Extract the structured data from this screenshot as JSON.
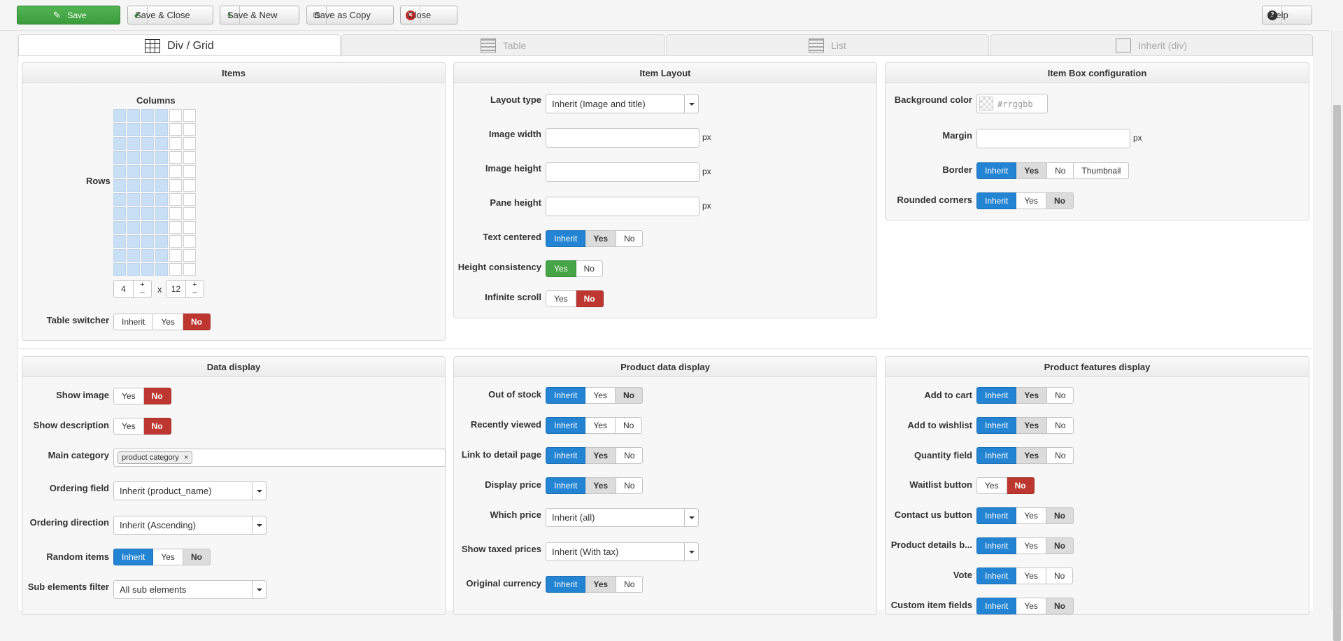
{
  "toolbar": {
    "save": "Save",
    "save_close": "Save & Close",
    "save_new": "Save & New",
    "save_copy": "Save as Copy",
    "close": "Close",
    "help": "Help"
  },
  "tabs": [
    "Div / Grid",
    "Table",
    "List",
    "Inherit (div)"
  ],
  "items_panel": {
    "title": "Items",
    "columns_label": "Columns",
    "rows_label": "Rows",
    "columns_value": "4",
    "x": "x",
    "rows_value": "12",
    "plus": "+",
    "minus": "–",
    "table_switcher": {
      "label": "Table switcher",
      "options": [
        "Inherit",
        "Yes",
        "No"
      ]
    }
  },
  "item_layout": {
    "title": "Item Layout",
    "layout_type": {
      "label": "Layout type",
      "value": "Inherit (Image and title)"
    },
    "image_width": {
      "label": "Image width",
      "unit": "px"
    },
    "image_height": {
      "label": "Image height",
      "unit": "px"
    },
    "pane_height": {
      "label": "Pane height",
      "unit": "px"
    },
    "text_centered": {
      "label": "Text centered",
      "options": [
        "Inherit",
        "Yes",
        "No"
      ]
    },
    "height_consistency": {
      "label": "Height consistency",
      "options": [
        "Yes",
        "No"
      ]
    },
    "infinite_scroll": {
      "label": "Infinite scroll",
      "options": [
        "Yes",
        "No"
      ]
    }
  },
  "item_box": {
    "title": "Item Box configuration",
    "background_color": {
      "label": "Background color",
      "placeholder": "#rrggbb"
    },
    "margin": {
      "label": "Margin",
      "unit": "px"
    },
    "border": {
      "label": "Border",
      "options": [
        "Inherit",
        "Yes",
        "No",
        "Thumbnail"
      ]
    },
    "rounded_corners": {
      "label": "Rounded corners",
      "options": [
        "Inherit",
        "Yes",
        "No"
      ]
    }
  },
  "data_display": {
    "title": "Data display",
    "show_image": {
      "label": "Show image",
      "options": [
        "Yes",
        "No"
      ]
    },
    "show_description": {
      "label": "Show description",
      "options": [
        "Yes",
        "No"
      ]
    },
    "main_category": {
      "label": "Main category",
      "tag": "product category",
      "tag_remove": "×"
    },
    "ordering_field": {
      "label": "Ordering field",
      "value": "Inherit (product_name)"
    },
    "ordering_direction": {
      "label": "Ordering direction",
      "value": "Inherit (Ascending)"
    },
    "random_items": {
      "label": "Random items",
      "options": [
        "Inherit",
        "Yes",
        "No"
      ]
    },
    "sub_elements_filter": {
      "label": "Sub elements filter",
      "value": "All sub elements"
    }
  },
  "product_data": {
    "title": "Product data display",
    "out_of_stock": {
      "label": "Out of stock",
      "options": [
        "Inherit",
        "Yes",
        "No"
      ]
    },
    "recently_viewed": {
      "label": "Recently viewed",
      "options": [
        "Inherit",
        "Yes",
        "No"
      ]
    },
    "link_detail": {
      "label": "Link to detail page",
      "options": [
        "Inherit",
        "Yes",
        "No"
      ]
    },
    "display_price": {
      "label": "Display price",
      "options": [
        "Inherit",
        "Yes",
        "No"
      ]
    },
    "which_price": {
      "label": "Which price",
      "value": "Inherit (all)"
    },
    "show_taxed": {
      "label": "Show taxed prices",
      "value": "Inherit (With tax)"
    },
    "original_currency": {
      "label": "Original currency",
      "options": [
        "Inherit",
        "Yes",
        "No"
      ]
    }
  },
  "product_features": {
    "title": "Product features display",
    "add_to_cart": {
      "label": "Add to cart",
      "options": [
        "Inherit",
        "Yes",
        "No"
      ]
    },
    "add_to_wishlist": {
      "label": "Add to wishlist",
      "options": [
        "Inherit",
        "Yes",
        "No"
      ]
    },
    "quantity_field": {
      "label": "Quantity field",
      "options": [
        "Inherit",
        "Yes",
        "No"
      ]
    },
    "waitlist_button": {
      "label": "Waitlist button",
      "options": [
        "Yes",
        "No"
      ]
    },
    "contact_us": {
      "label": "Contact us button",
      "options": [
        "Inherit",
        "Yes",
        "No"
      ]
    },
    "product_details": {
      "label": "Product details b...",
      "options": [
        "Inherit",
        "Yes",
        "No"
      ]
    },
    "vote": {
      "label": "Vote",
      "options": [
        "Inherit",
        "Yes",
        "No"
      ]
    },
    "custom_fields": {
      "label": "Custom item fields",
      "options": [
        "Inherit",
        "Yes",
        "No"
      ]
    }
  },
  "colors": {
    "accent_blue": "#2384d3",
    "danger_red": "#bd362f",
    "success_green": "#46a546"
  }
}
